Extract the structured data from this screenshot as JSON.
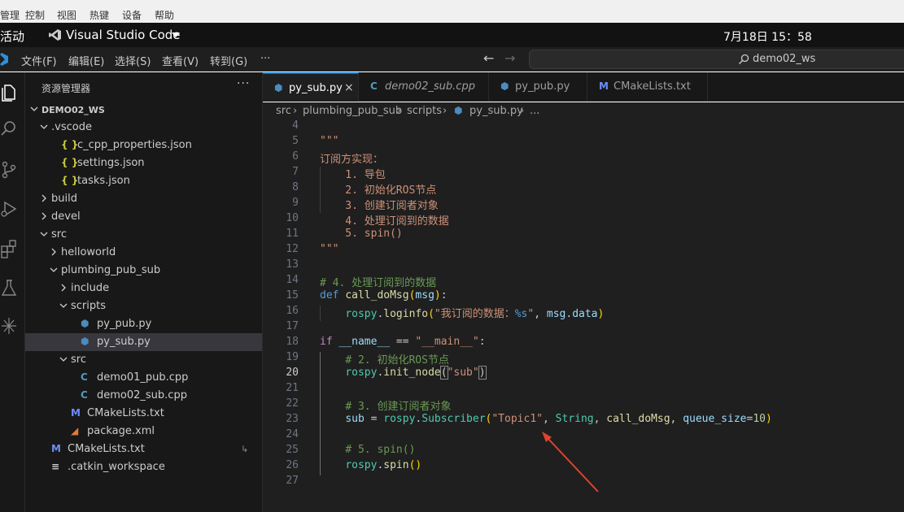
{
  "vm_menu": [
    "管理",
    "控制",
    "视图",
    "热键",
    "设备",
    "帮助"
  ],
  "topbar": {
    "activities": "活动",
    "app_name": "Visual Studio Code",
    "clock": "7月18日  15：58"
  },
  "titlebar": {
    "menus": [
      "文件(F)",
      "编辑(E)",
      "选择(S)",
      "查看(V)",
      "转到(G)",
      "···"
    ],
    "search_text": "demo02_ws"
  },
  "activity_icons": [
    "explorer-icon",
    "search-icon",
    "source-control-icon",
    "run-debug-icon",
    "extensions-icon",
    "testing-icon",
    "ros-icon"
  ],
  "sidebar": {
    "title": "资源管理器",
    "more": "···",
    "badge": "↳",
    "tree": [
      {
        "label": "DEMO02_WS",
        "depth": 0,
        "kind": "folder-open",
        "bold": true
      },
      {
        "label": ".vscode",
        "depth": 1,
        "kind": "folder-open"
      },
      {
        "label": "c_cpp_properties.json",
        "depth": 2,
        "kind": "json"
      },
      {
        "label": "settings.json",
        "depth": 2,
        "kind": "json"
      },
      {
        "label": "tasks.json",
        "depth": 2,
        "kind": "json"
      },
      {
        "label": "build",
        "depth": 1,
        "kind": "folder-closed"
      },
      {
        "label": "devel",
        "depth": 1,
        "kind": "folder-closed"
      },
      {
        "label": "src",
        "depth": 1,
        "kind": "folder-open"
      },
      {
        "label": "helloworld",
        "depth": 2,
        "kind": "folder-closed"
      },
      {
        "label": "plumbing_pub_sub",
        "depth": 2,
        "kind": "folder-open"
      },
      {
        "label": "include",
        "depth": 3,
        "kind": "folder-closed"
      },
      {
        "label": "scripts",
        "depth": 3,
        "kind": "folder-open"
      },
      {
        "label": "py_pub.py",
        "depth": 4,
        "kind": "python"
      },
      {
        "label": "py_sub.py",
        "depth": 4,
        "kind": "python",
        "selected": true
      },
      {
        "label": "src",
        "depth": 3,
        "kind": "folder-open"
      },
      {
        "label": "demo01_pub.cpp",
        "depth": 4,
        "kind": "cpp"
      },
      {
        "label": "demo02_sub.cpp",
        "depth": 4,
        "kind": "cpp"
      },
      {
        "label": "CMakeLists.txt",
        "depth": 3,
        "kind": "cmake"
      },
      {
        "label": "package.xml",
        "depth": 3,
        "kind": "xml"
      },
      {
        "label": "CMakeLists.txt",
        "depth": 1,
        "kind": "cmake"
      },
      {
        "label": ".catkin_workspace",
        "depth": 1,
        "kind": "text"
      }
    ]
  },
  "tabs": [
    {
      "name": "py_sub.py",
      "kind": "python",
      "active": true,
      "close": "×"
    },
    {
      "name": "demo02_sub.cpp",
      "kind": "cpp",
      "italic": true
    },
    {
      "name": "py_pub.py",
      "kind": "python"
    },
    {
      "name": "CMakeLists.txt",
      "kind": "cmake"
    }
  ],
  "breadcrumb": [
    "src",
    "plumbing_pub_sub",
    "scripts",
    "py_sub.py",
    "..."
  ],
  "editor": {
    "active_line": 20,
    "lines": [
      {
        "n": 4,
        "code": []
      },
      {
        "n": 5,
        "code": [
          [
            "s",
            "\"\"\""
          ]
        ]
      },
      {
        "n": 6,
        "code": [
          [
            "s",
            "订阅方实现："
          ]
        ]
      },
      {
        "n": 7,
        "code": [
          [
            "s",
            "    1. 导包"
          ]
        ]
      },
      {
        "n": 8,
        "code": [
          [
            "s",
            "    2. 初始化ROS节点"
          ]
        ]
      },
      {
        "n": 9,
        "code": [
          [
            "s",
            "    3. 创建订阅者对象"
          ]
        ]
      },
      {
        "n": 10,
        "code": [
          [
            "s",
            "    4. 处理订阅到的数据"
          ]
        ]
      },
      {
        "n": 11,
        "code": [
          [
            "s",
            "    5. spin()"
          ]
        ]
      },
      {
        "n": 12,
        "code": [
          [
            "s",
            "\"\"\""
          ]
        ]
      },
      {
        "n": 13,
        "code": []
      },
      {
        "n": 14,
        "code": [
          [
            "c",
            "# 4. 处理订阅到的数据"
          ]
        ]
      },
      {
        "n": 15,
        "code": [
          [
            "k",
            "def"
          ],
          [
            "p",
            " "
          ],
          [
            "f",
            "call_doMsg"
          ],
          [
            "br1",
            "("
          ],
          [
            "v",
            "msg"
          ],
          [
            "br1",
            ")"
          ],
          [
            "p",
            ":"
          ]
        ]
      },
      {
        "n": 16,
        "code": [
          [
            "p",
            "    "
          ],
          [
            "t",
            "rospy"
          ],
          [
            "p",
            "."
          ],
          [
            "f",
            "loginfo"
          ],
          [
            "br1",
            "("
          ],
          [
            "s",
            "\"我订阅的数据："
          ],
          [
            "k",
            "%s"
          ],
          [
            "s",
            "\""
          ],
          [
            "p",
            ", "
          ],
          [
            "v",
            "msg"
          ],
          [
            "p",
            "."
          ],
          [
            "v",
            "data"
          ],
          [
            "br1",
            ")"
          ]
        ]
      },
      {
        "n": 17,
        "code": []
      },
      {
        "n": 18,
        "code": [
          [
            "m",
            "if"
          ],
          [
            "p",
            " "
          ],
          [
            "v",
            "__name__"
          ],
          [
            "p",
            " == "
          ],
          [
            "s",
            "\"__main__\""
          ],
          [
            "p",
            ":"
          ]
        ]
      },
      {
        "n": 19,
        "code": [
          [
            "p",
            "    "
          ],
          [
            "c",
            "# 2. 初始化ROS节点"
          ]
        ]
      },
      {
        "n": 20,
        "code": [
          [
            "p",
            "    "
          ],
          [
            "t",
            "rospy"
          ],
          [
            "p",
            "."
          ],
          [
            "f",
            "init_node"
          ],
          [
            "bm",
            "("
          ],
          [
            "s",
            "\"sub\""
          ],
          [
            "bm",
            ")"
          ]
        ]
      },
      {
        "n": 21,
        "code": []
      },
      {
        "n": 22,
        "code": [
          [
            "p",
            "    "
          ],
          [
            "c",
            "# 3. 创建订阅者对象"
          ]
        ]
      },
      {
        "n": 23,
        "code": [
          [
            "p",
            "    "
          ],
          [
            "v",
            "sub"
          ],
          [
            "p",
            " = "
          ],
          [
            "t",
            "rospy"
          ],
          [
            "p",
            "."
          ],
          [
            "t",
            "Subscriber"
          ],
          [
            "br1",
            "("
          ],
          [
            "s",
            "\"Topic1\""
          ],
          [
            "p",
            ", "
          ],
          [
            "t",
            "String"
          ],
          [
            "p",
            ", "
          ],
          [
            "f",
            "call_doMsg"
          ],
          [
            "p",
            ", "
          ],
          [
            "v",
            "queue_size"
          ],
          [
            "p",
            "="
          ],
          [
            "n",
            "10"
          ],
          [
            "br1",
            ")"
          ]
        ]
      },
      {
        "n": 24,
        "code": []
      },
      {
        "n": 25,
        "code": [
          [
            "p",
            "    "
          ],
          [
            "c",
            "# 5. spin()"
          ]
        ]
      },
      {
        "n": 26,
        "code": [
          [
            "p",
            "    "
          ],
          [
            "t",
            "rospy"
          ],
          [
            "p",
            "."
          ],
          [
            "f",
            "spin"
          ],
          [
            "br1",
            "()"
          ]
        ]
      },
      {
        "n": 27,
        "code": []
      }
    ]
  },
  "colors": {
    "accent": "#0078d4",
    "arrow": "#e0442c"
  }
}
